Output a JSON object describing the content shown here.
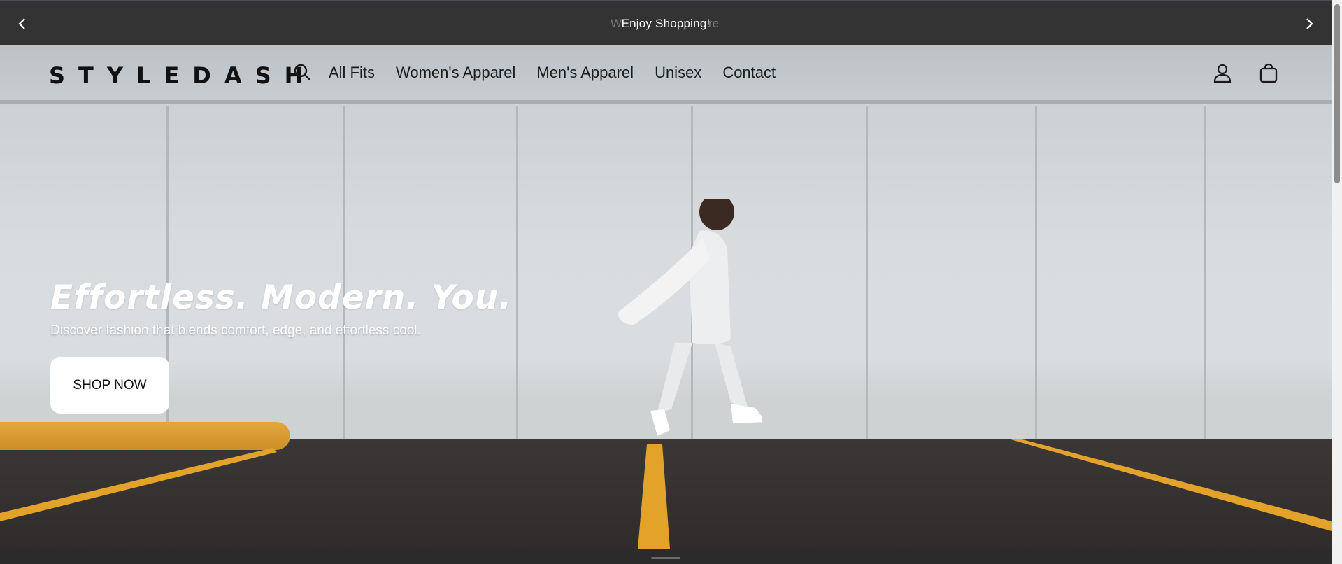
{
  "announcement": {
    "message": "Enjoy Shopping!",
    "ghost_left": "W",
    "ghost_right": "re"
  },
  "brand": {
    "logo": "STYLEDASH"
  },
  "nav": {
    "items": [
      "All Fits",
      "Women's Apparel",
      "Men's Apparel",
      "Unisex",
      "Contact"
    ]
  },
  "hero": {
    "headline": "Effortless. Modern. You.",
    "subline": "Discover fashion that blends comfort, edge, and effortless cool.",
    "cta": "SHOP NOW"
  },
  "colors": {
    "announcement_bg": "#333333",
    "accent_yellow": "#e3a32a"
  },
  "icons": {
    "prev": "chevron-left-icon",
    "next": "chevron-right-icon",
    "search": "search-icon",
    "account": "user-icon",
    "cart": "bag-icon"
  }
}
